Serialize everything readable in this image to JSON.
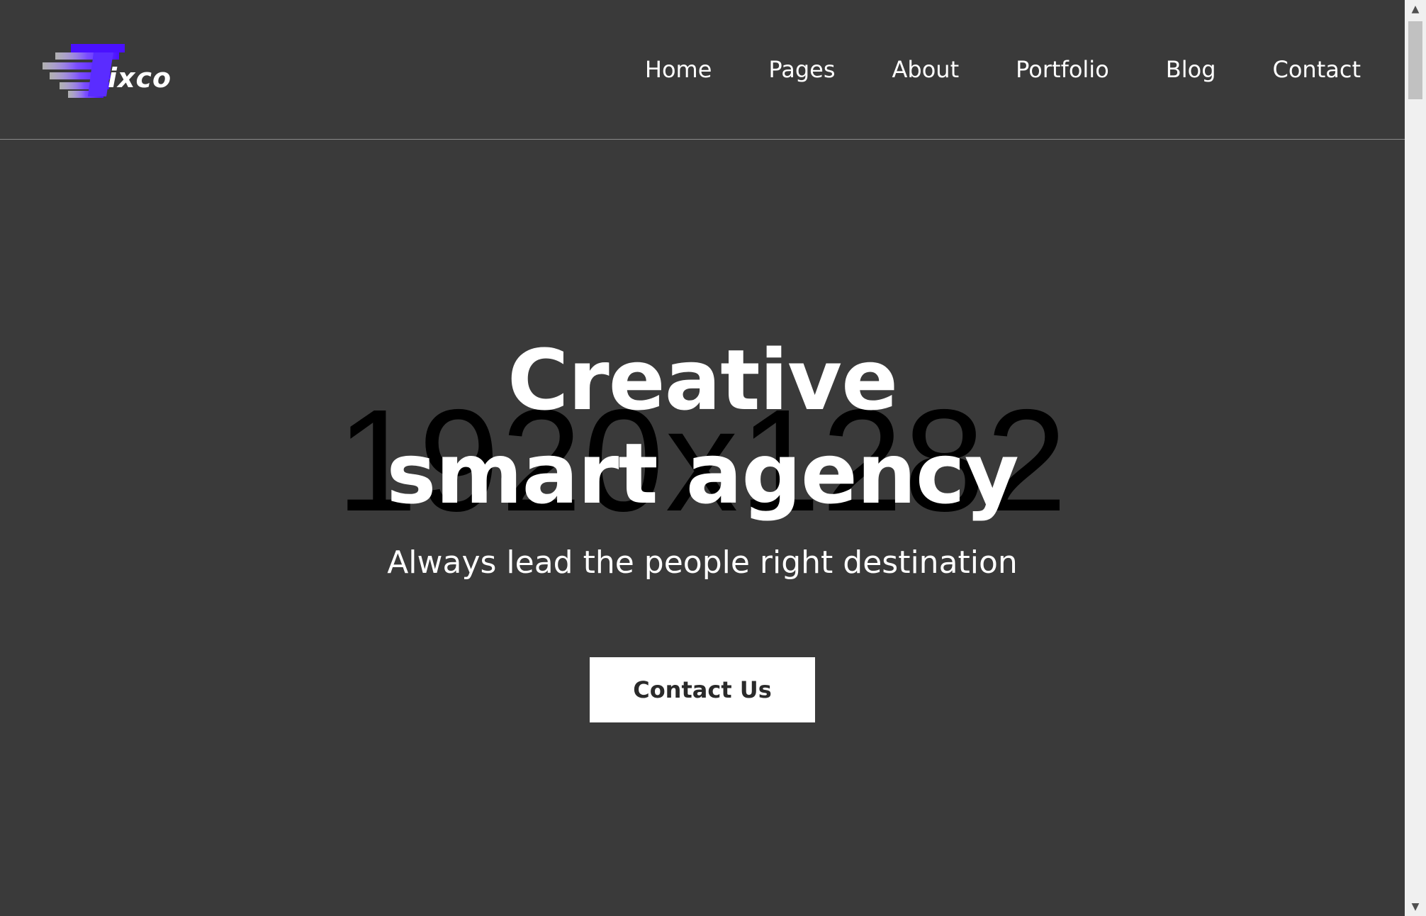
{
  "brand": {
    "logo_text": "ixco",
    "logo_color": "#5a2cff"
  },
  "nav": {
    "items": [
      {
        "label": "Home"
      },
      {
        "label": "Pages"
      },
      {
        "label": "About"
      },
      {
        "label": "Portfolio"
      },
      {
        "label": "Blog"
      },
      {
        "label": "Contact"
      }
    ]
  },
  "hero": {
    "watermark": "1920x1282",
    "title_line1": "Creative",
    "title_line2": "smart agency",
    "subtitle": "Always lead the people right destination",
    "cta_label": "Contact Us"
  },
  "colors": {
    "background": "#3a3a3a",
    "text": "#ffffff",
    "button_bg": "#ffffff",
    "button_text": "#2a2a2a"
  },
  "scrollbar": {
    "up_icon": "chevron-up-icon",
    "down_icon": "chevron-down-icon"
  }
}
